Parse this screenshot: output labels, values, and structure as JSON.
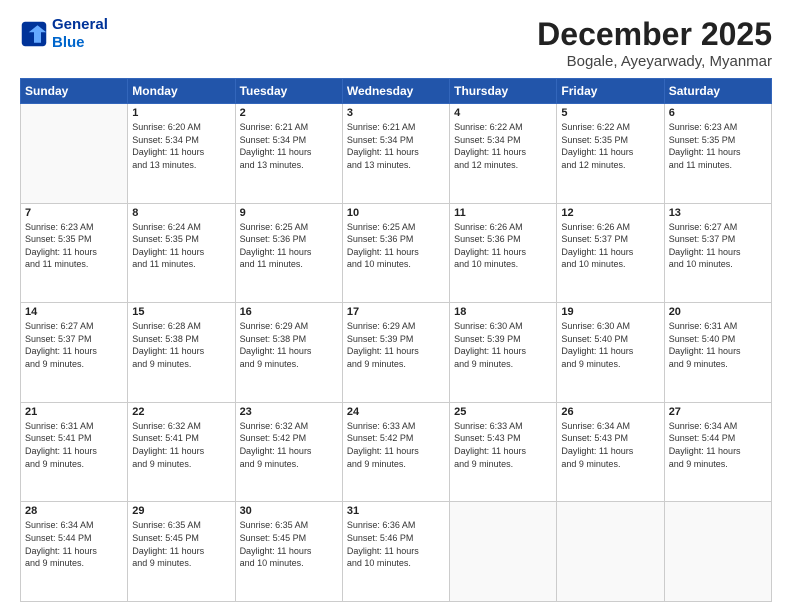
{
  "header": {
    "logo_line1": "General",
    "logo_line2": "Blue",
    "title": "December 2025",
    "subtitle": "Bogale, Ayeyarwady, Myanmar"
  },
  "days_of_week": [
    "Sunday",
    "Monday",
    "Tuesday",
    "Wednesday",
    "Thursday",
    "Friday",
    "Saturday"
  ],
  "weeks": [
    [
      {
        "day": "",
        "info": ""
      },
      {
        "day": "1",
        "info": "Sunrise: 6:20 AM\nSunset: 5:34 PM\nDaylight: 11 hours\nand 13 minutes."
      },
      {
        "day": "2",
        "info": "Sunrise: 6:21 AM\nSunset: 5:34 PM\nDaylight: 11 hours\nand 13 minutes."
      },
      {
        "day": "3",
        "info": "Sunrise: 6:21 AM\nSunset: 5:34 PM\nDaylight: 11 hours\nand 13 minutes."
      },
      {
        "day": "4",
        "info": "Sunrise: 6:22 AM\nSunset: 5:34 PM\nDaylight: 11 hours\nand 12 minutes."
      },
      {
        "day": "5",
        "info": "Sunrise: 6:22 AM\nSunset: 5:35 PM\nDaylight: 11 hours\nand 12 minutes."
      },
      {
        "day": "6",
        "info": "Sunrise: 6:23 AM\nSunset: 5:35 PM\nDaylight: 11 hours\nand 11 minutes."
      }
    ],
    [
      {
        "day": "7",
        "info": "Sunrise: 6:23 AM\nSunset: 5:35 PM\nDaylight: 11 hours\nand 11 minutes."
      },
      {
        "day": "8",
        "info": "Sunrise: 6:24 AM\nSunset: 5:35 PM\nDaylight: 11 hours\nand 11 minutes."
      },
      {
        "day": "9",
        "info": "Sunrise: 6:25 AM\nSunset: 5:36 PM\nDaylight: 11 hours\nand 11 minutes."
      },
      {
        "day": "10",
        "info": "Sunrise: 6:25 AM\nSunset: 5:36 PM\nDaylight: 11 hours\nand 10 minutes."
      },
      {
        "day": "11",
        "info": "Sunrise: 6:26 AM\nSunset: 5:36 PM\nDaylight: 11 hours\nand 10 minutes."
      },
      {
        "day": "12",
        "info": "Sunrise: 6:26 AM\nSunset: 5:37 PM\nDaylight: 11 hours\nand 10 minutes."
      },
      {
        "day": "13",
        "info": "Sunrise: 6:27 AM\nSunset: 5:37 PM\nDaylight: 11 hours\nand 10 minutes."
      }
    ],
    [
      {
        "day": "14",
        "info": "Sunrise: 6:27 AM\nSunset: 5:37 PM\nDaylight: 11 hours\nand 9 minutes."
      },
      {
        "day": "15",
        "info": "Sunrise: 6:28 AM\nSunset: 5:38 PM\nDaylight: 11 hours\nand 9 minutes."
      },
      {
        "day": "16",
        "info": "Sunrise: 6:29 AM\nSunset: 5:38 PM\nDaylight: 11 hours\nand 9 minutes."
      },
      {
        "day": "17",
        "info": "Sunrise: 6:29 AM\nSunset: 5:39 PM\nDaylight: 11 hours\nand 9 minutes."
      },
      {
        "day": "18",
        "info": "Sunrise: 6:30 AM\nSunset: 5:39 PM\nDaylight: 11 hours\nand 9 minutes."
      },
      {
        "day": "19",
        "info": "Sunrise: 6:30 AM\nSunset: 5:40 PM\nDaylight: 11 hours\nand 9 minutes."
      },
      {
        "day": "20",
        "info": "Sunrise: 6:31 AM\nSunset: 5:40 PM\nDaylight: 11 hours\nand 9 minutes."
      }
    ],
    [
      {
        "day": "21",
        "info": "Sunrise: 6:31 AM\nSunset: 5:41 PM\nDaylight: 11 hours\nand 9 minutes."
      },
      {
        "day": "22",
        "info": "Sunrise: 6:32 AM\nSunset: 5:41 PM\nDaylight: 11 hours\nand 9 minutes."
      },
      {
        "day": "23",
        "info": "Sunrise: 6:32 AM\nSunset: 5:42 PM\nDaylight: 11 hours\nand 9 minutes."
      },
      {
        "day": "24",
        "info": "Sunrise: 6:33 AM\nSunset: 5:42 PM\nDaylight: 11 hours\nand 9 minutes."
      },
      {
        "day": "25",
        "info": "Sunrise: 6:33 AM\nSunset: 5:43 PM\nDaylight: 11 hours\nand 9 minutes."
      },
      {
        "day": "26",
        "info": "Sunrise: 6:34 AM\nSunset: 5:43 PM\nDaylight: 11 hours\nand 9 minutes."
      },
      {
        "day": "27",
        "info": "Sunrise: 6:34 AM\nSunset: 5:44 PM\nDaylight: 11 hours\nand 9 minutes."
      }
    ],
    [
      {
        "day": "28",
        "info": "Sunrise: 6:34 AM\nSunset: 5:44 PM\nDaylight: 11 hours\nand 9 minutes."
      },
      {
        "day": "29",
        "info": "Sunrise: 6:35 AM\nSunset: 5:45 PM\nDaylight: 11 hours\nand 9 minutes."
      },
      {
        "day": "30",
        "info": "Sunrise: 6:35 AM\nSunset: 5:45 PM\nDaylight: 11 hours\nand 10 minutes."
      },
      {
        "day": "31",
        "info": "Sunrise: 6:36 AM\nSunset: 5:46 PM\nDaylight: 11 hours\nand 10 minutes."
      },
      {
        "day": "",
        "info": ""
      },
      {
        "day": "",
        "info": ""
      },
      {
        "day": "",
        "info": ""
      }
    ]
  ]
}
